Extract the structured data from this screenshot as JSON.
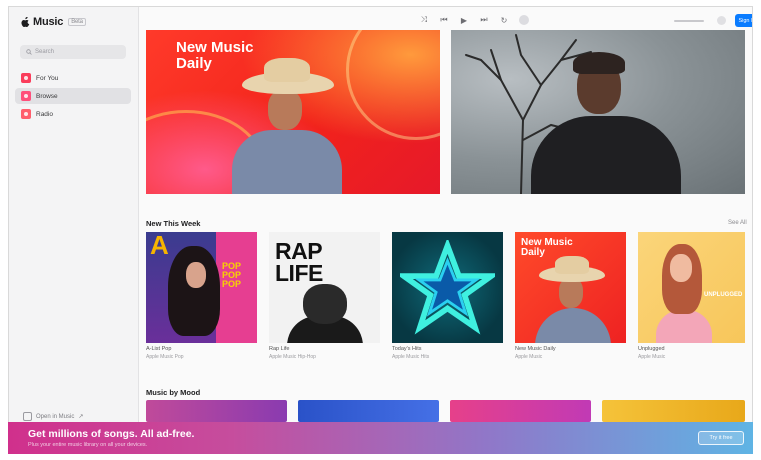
{
  "app": {
    "logo_text": "Music",
    "beta_badge": "Beta"
  },
  "sidebar": {
    "search_placeholder": "Search",
    "items": [
      {
        "label": "For You",
        "icon": "heart-icon"
      },
      {
        "label": "Browse",
        "icon": "music-note-icon",
        "active": true
      },
      {
        "label": "Radio",
        "icon": "radio-icon"
      }
    ],
    "open_in_music": "Open in Music"
  },
  "toolbar": {
    "sign_in_label": "Sign In"
  },
  "hero": {
    "left_title": "New Music\nDaily"
  },
  "new_this_week": {
    "title": "New This Week",
    "see_all": "See All",
    "tiles": [
      {
        "title": "A-List Pop",
        "subtitle": "Apple Music Pop",
        "art_big_letter": "A",
        "art_text": "POP\nPOP\nPOP"
      },
      {
        "title": "Rap Life",
        "subtitle": "Apple Music Hip-Hop",
        "art_text": "RAP\nLIFE"
      },
      {
        "title": "Today's Hits",
        "subtitle": "Apple Music Hits"
      },
      {
        "title": "New Music Daily",
        "subtitle": "Apple Music",
        "art_text": "New Music\nDaily"
      },
      {
        "title": "Unplugged",
        "subtitle": "Apple Music",
        "art_text": "UNPLUGGED"
      }
    ]
  },
  "music_by_mood": {
    "title": "Music by Mood"
  },
  "banner": {
    "title": "Get millions of songs. All ad-free.",
    "subtitle": "Plus your entire music library on all your devices.",
    "button_label": "Try it free"
  }
}
